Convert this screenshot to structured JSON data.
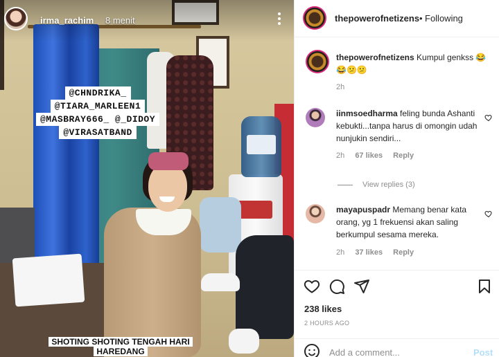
{
  "story": {
    "username": "irma_rachim",
    "time": "8 menit",
    "mentions": [
      "@CHNDRIKA_",
      "@TIARA_MARLEEN1",
      "@MASBRAY666_ @_DIDOY",
      "@VIRASATBAND"
    ],
    "caption": "SHOTING SHOTING TENGAH HARI HAREDANG"
  },
  "header": {
    "username": "thepowerofnetizens",
    "separator": "•",
    "follow_state": "Following"
  },
  "caption": {
    "username": "thepowerofnetizens",
    "text": "Kumpul genkss 😂😂😕😕",
    "age": "2h"
  },
  "comments": [
    {
      "username": "iinmsoedharma",
      "text": "feling bunda Ashanti kebukti...tanpa harus di omongin udah nunjukin sendiri...",
      "age": "2h",
      "likes": "67 likes",
      "reply": "Reply",
      "view_replies": "View replies (3)"
    },
    {
      "username": "mayapuspadr",
      "text": "Memang benar kata orang, yg 1 frekuensi akan saling berkumpul sesama mereka.",
      "age": "2h",
      "likes": "37 likes",
      "reply": "Reply"
    }
  ],
  "actions": {
    "likes": "238 likes",
    "ago": "2 HOURS AGO",
    "add_comment_placeholder": "Add a comment...",
    "post_label": "Post",
    "icons": [
      "heart-icon",
      "comment-icon",
      "share-icon",
      "bookmark-icon",
      "emoji-icon"
    ]
  }
}
